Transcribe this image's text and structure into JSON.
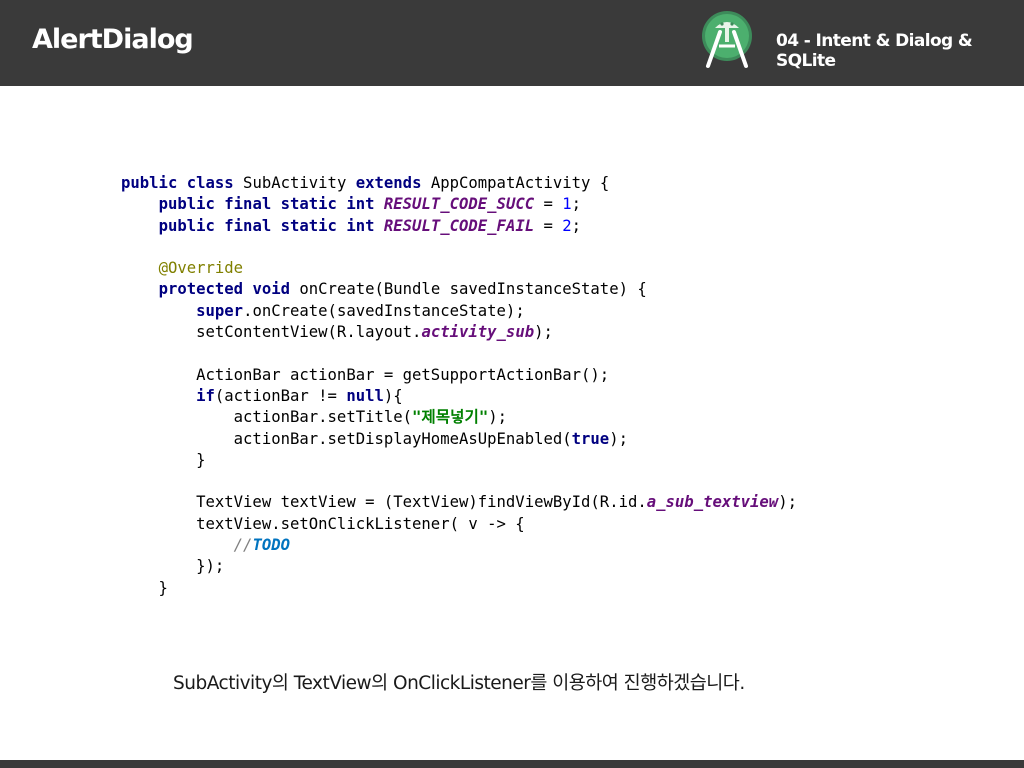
{
  "header": {
    "title": "AlertDialog",
    "subtitle": "04 - Intent & Dialog & SQLite",
    "logo_icon": "android-studio-icon"
  },
  "colors": {
    "header_bg": "#3a3a3a",
    "keyword": "#000080",
    "number": "#0000ff",
    "field": "#660e7a",
    "annotation": "#808000",
    "string": "#008000",
    "comment": "#808080",
    "todo": "#0073bf"
  },
  "code": {
    "lines": [
      [
        {
          "t": "kw",
          "v": "public class"
        },
        {
          "t": "p",
          "v": " SubActivity "
        },
        {
          "t": "kw",
          "v": "extends"
        },
        {
          "t": "p",
          "v": " AppCompatActivity {"
        }
      ],
      [
        {
          "t": "p",
          "v": "    "
        },
        {
          "t": "kw",
          "v": "public final static int"
        },
        {
          "t": "p",
          "v": " "
        },
        {
          "t": "field",
          "v": "RESULT_CODE_SUCC"
        },
        {
          "t": "p",
          "v": " = "
        },
        {
          "t": "num",
          "v": "1"
        },
        {
          "t": "p",
          "v": ";"
        }
      ],
      [
        {
          "t": "p",
          "v": "    "
        },
        {
          "t": "kw",
          "v": "public final static int"
        },
        {
          "t": "p",
          "v": " "
        },
        {
          "t": "field",
          "v": "RESULT_CODE_FAIL"
        },
        {
          "t": "p",
          "v": " = "
        },
        {
          "t": "num",
          "v": "2"
        },
        {
          "t": "p",
          "v": ";"
        }
      ],
      [],
      [
        {
          "t": "p",
          "v": "    "
        },
        {
          "t": "ann",
          "v": "@Override"
        }
      ],
      [
        {
          "t": "p",
          "v": "    "
        },
        {
          "t": "kw",
          "v": "protected void"
        },
        {
          "t": "p",
          "v": " onCreate(Bundle savedInstanceState) {"
        }
      ],
      [
        {
          "t": "p",
          "v": "        "
        },
        {
          "t": "kw",
          "v": "super"
        },
        {
          "t": "p",
          "v": ".onCreate(savedInstanceState);"
        }
      ],
      [
        {
          "t": "p",
          "v": "        setContentView(R.layout."
        },
        {
          "t": "field",
          "v": "activity_sub"
        },
        {
          "t": "p",
          "v": ");"
        }
      ],
      [],
      [
        {
          "t": "p",
          "v": "        ActionBar actionBar = getSupportActionBar();"
        }
      ],
      [
        {
          "t": "p",
          "v": "        "
        },
        {
          "t": "kw",
          "v": "if"
        },
        {
          "t": "p",
          "v": "(actionBar != "
        },
        {
          "t": "kw",
          "v": "null"
        },
        {
          "t": "p",
          "v": "){"
        }
      ],
      [
        {
          "t": "p",
          "v": "            actionBar.setTitle("
        },
        {
          "t": "str",
          "v": "\"제목넣기\""
        },
        {
          "t": "p",
          "v": ");"
        }
      ],
      [
        {
          "t": "p",
          "v": "            actionBar.setDisplayHomeAsUpEnabled("
        },
        {
          "t": "kw",
          "v": "true"
        },
        {
          "t": "p",
          "v": ");"
        }
      ],
      [
        {
          "t": "p",
          "v": "        }"
        }
      ],
      [],
      [
        {
          "t": "p",
          "v": "        TextView textView = (TextView)findViewById(R.id."
        },
        {
          "t": "field",
          "v": "a_sub_textview"
        },
        {
          "t": "p",
          "v": ");"
        }
      ],
      [
        {
          "t": "p",
          "v": "        textView.setOnClickListener( v -> {"
        }
      ],
      [
        {
          "t": "p",
          "v": "            "
        },
        {
          "t": "cmt",
          "v": "//"
        },
        {
          "t": "todo",
          "v": "TODO"
        }
      ],
      [
        {
          "t": "p",
          "v": "        });"
        }
      ],
      [
        {
          "t": "p",
          "v": "    }"
        }
      ]
    ]
  },
  "caption": "SubActivity의 TextView의 OnClickListener를 이용하여 진행하겠습니다."
}
